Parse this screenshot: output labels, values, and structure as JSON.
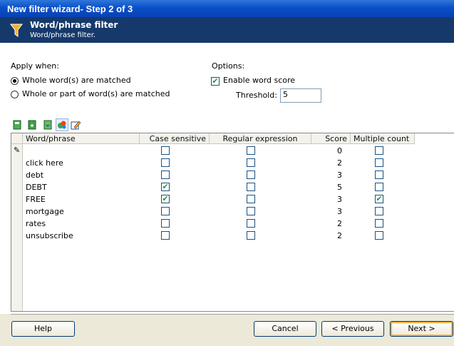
{
  "window": {
    "title": "New filter wizard- Step 2 of 3"
  },
  "header": {
    "title": "Word/phrase filter",
    "subtitle": "Word/phrase filter."
  },
  "apply": {
    "label": "Apply when:",
    "opt_whole": "Whole word(s) are matched",
    "opt_part": "Whole or part of word(s) are matched",
    "selected": "whole"
  },
  "options": {
    "label": "Options:",
    "enable_score_label": "Enable word score",
    "enable_score_checked": true,
    "threshold_label": "Threshold:",
    "threshold_value": "5"
  },
  "toolbar": [
    "add-icon",
    "insert-icon",
    "import-icon",
    "filter-icon",
    "edit-icon"
  ],
  "grid": {
    "columns": {
      "word": "Word/phrase",
      "case": "Case sensitive",
      "regex": "Regular expression",
      "score": "Score",
      "multi": "Multiple count"
    },
    "rows": [
      {
        "word": "",
        "case": false,
        "regex": false,
        "score": "0",
        "multi": false,
        "editing": true
      },
      {
        "word": "click here",
        "case": false,
        "regex": false,
        "score": "2",
        "multi": false
      },
      {
        "word": "debt",
        "case": false,
        "regex": false,
        "score": "3",
        "multi": false
      },
      {
        "word": "DEBT",
        "case": true,
        "regex": false,
        "score": "5",
        "multi": false
      },
      {
        "word": "FREE",
        "case": true,
        "regex": false,
        "score": "3",
        "multi": true
      },
      {
        "word": "mortgage",
        "case": false,
        "regex": false,
        "score": "3",
        "multi": false
      },
      {
        "word": "rates",
        "case": false,
        "regex": false,
        "score": "2",
        "multi": false
      },
      {
        "word": "unsubscribe",
        "case": false,
        "regex": false,
        "score": "2",
        "multi": false
      }
    ]
  },
  "buttons": {
    "help": "Help",
    "cancel": "Cancel",
    "previous": "< Previous",
    "next": "Next >"
  },
  "colors": {
    "header_bg": "#16396b",
    "titlebar": "#0a4fc9",
    "check": "#2a9a2a"
  }
}
